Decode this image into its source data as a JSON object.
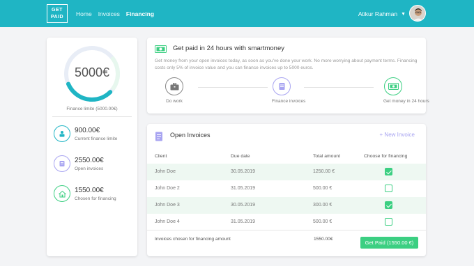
{
  "header": {
    "logo_line1": "GET",
    "logo_line2": "PAID",
    "nav": [
      "Home",
      "Invoices",
      "Financing"
    ],
    "active_nav": "Financing",
    "user_name": "Atikur Rahman"
  },
  "colors": {
    "brand": "#1fb5c4",
    "green": "#3ccf82",
    "purple": "#a8a4f1",
    "row_highlight": "#eef8f2"
  },
  "summary": {
    "gauge_value": "5000€",
    "gauge_fill_fraction": 0.31,
    "finance_limit_label": "Finance limite (5000.00€)",
    "stats": [
      {
        "value": "900.00€",
        "label": "Current finance limite",
        "icon": "person-icon"
      },
      {
        "value": "2550.00€",
        "label": "Open invoices",
        "icon": "invoice-icon"
      },
      {
        "value": "1550.00€",
        "label": "Chosen for financing",
        "icon": "home-icon"
      }
    ]
  },
  "promo": {
    "title": "Get paid in 24 hours with smartmoney",
    "description": "Get money from your open invoices today, as soon as you've done your work. No more worrying about payment terms. Financing costs only 5% of invoice value and you can finance invoices up to 5000 euros.",
    "steps": [
      {
        "label": "Do work",
        "icon": "briefcase-icon"
      },
      {
        "label": "Finance invoices",
        "icon": "invoice-icon"
      },
      {
        "label": "Get money in 24 hours",
        "icon": "cash-icon"
      }
    ]
  },
  "invoices": {
    "title": "Open Invoices",
    "new_label": "+ New Invoice",
    "columns": [
      "Client",
      "Due date",
      "Total amount",
      "Choose for financing"
    ],
    "rows": [
      {
        "client": "John Doe",
        "due": "30.05.2019",
        "amount": "1250.00 €",
        "chosen": true
      },
      {
        "client": "John Doe 2",
        "due": "31.05.2019",
        "amount": "500.00 €",
        "chosen": false
      },
      {
        "client": "John Doe 3",
        "due": "30.05.2019",
        "amount": "300.00 €",
        "chosen": true
      },
      {
        "client": "John Doe 4",
        "due": "31.05.2019",
        "amount": "500.00 €",
        "chosen": false
      }
    ],
    "footer_label": "Invoices chosen for financing amount",
    "footer_amount": "1550.00€",
    "button_label": "Get Paid (1550.00 €)"
  }
}
